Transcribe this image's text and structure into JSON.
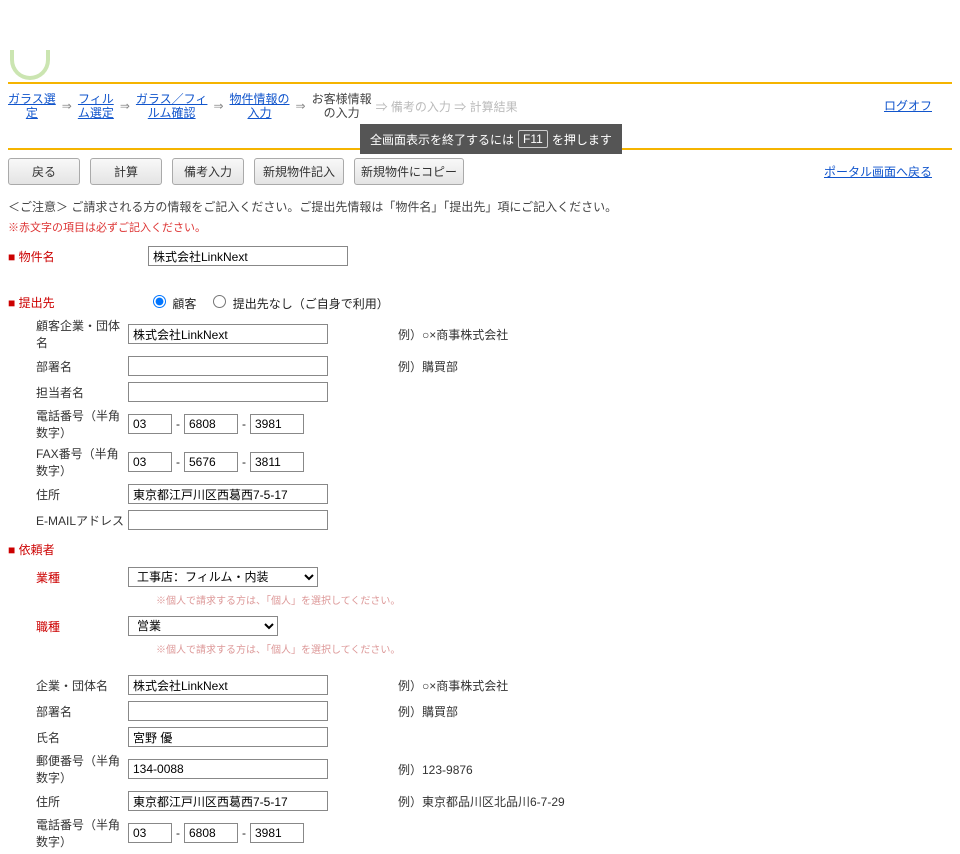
{
  "breadcrumb": {
    "items": [
      {
        "label": "ガラス選\n定"
      },
      {
        "label": "フィル\nム選定"
      },
      {
        "label": "ガラス／フィ\nルム確認"
      },
      {
        "label": "物件情報の\n入力"
      }
    ],
    "current": "お客様情報\nの入力",
    "ghost": "⇒ 備考の入力 ⇒ 計算結果",
    "logoff": "ログオフ"
  },
  "tooltip": {
    "pre": "全画面表示を終了するには",
    "key": "F11",
    "post": "を押します"
  },
  "buttons": {
    "back": "戻る",
    "calc": "計算",
    "notes": "備考入力",
    "new_entry": "新規物件記入",
    "new_copy": "新規物件にコピー",
    "portal": "ポータル画面へ戻る"
  },
  "notices": {
    "main": "＜ご注意＞ ご請求される方の情報をご記入ください。ご提出先情報は「物件名」「提出先」項にご記入ください。",
    "red": "※赤文字の項目は必ずご記入ください。"
  },
  "labels": {
    "property": "■ 物件名",
    "submit_to": "■ 提出先",
    "requester": "■ 依頼者",
    "company": "顧客企業・団体名",
    "company2": "企業・団体名",
    "dept": "部署名",
    "person": "担当者名",
    "tel": "電話番号（半角数字）",
    "fax": "FAX番号（半角数字）",
    "addr": "住所",
    "email": "E-MAILアドレス",
    "industry": "業種",
    "jobtype": "職種",
    "name": "氏名",
    "postal": "郵便番号（半角数字）"
  },
  "radio": {
    "customer": "顧客",
    "none": "提出先なし（ご自身で利用）"
  },
  "examples": {
    "company": "例）○×商事株式会社",
    "dept": "例）購買部",
    "postal": "例）123-9876",
    "addr": "例）東京都品川区北品川6-7-29"
  },
  "hints": {
    "personal": "※個人で請求する方は、「個人」を選択してください。"
  },
  "values": {
    "property_name": "株式会社LinkNext",
    "customer_company": "株式会社LinkNext",
    "customer_dept": "",
    "customer_person": "",
    "tel": {
      "a": "03",
      "b": "6808",
      "c": "3981"
    },
    "fax": {
      "a": "03",
      "b": "5676",
      "c": "3811"
    },
    "customer_addr": "東京都江戸川区西葛西7-5-17",
    "customer_email": "",
    "industry": "工事店：フィルム・内装",
    "jobtype": "営業",
    "req_company": "株式会社LinkNext",
    "req_dept": "",
    "req_name": "宮野 優",
    "req_postal": "134-0088",
    "req_addr": "東京都江戸川区西葛西7-5-17",
    "req_tel": {
      "a": "03",
      "b": "6808",
      "c": "3981"
    }
  }
}
